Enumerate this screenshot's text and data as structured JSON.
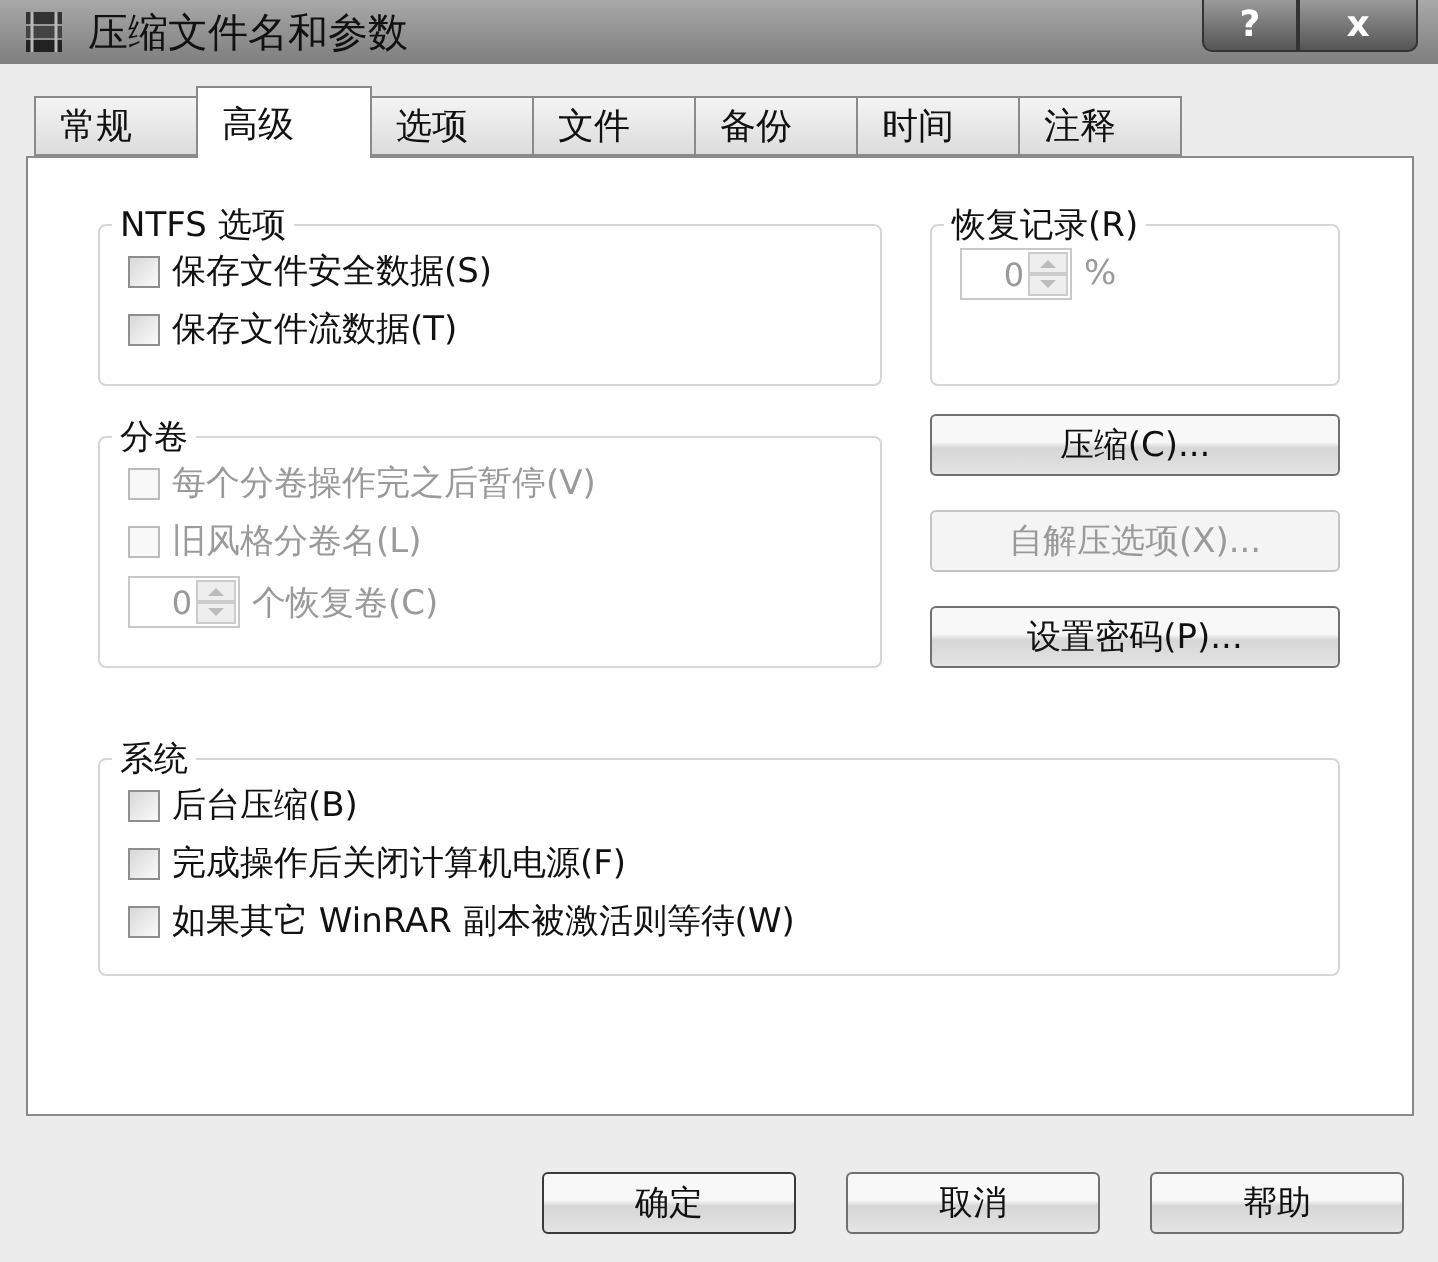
{
  "window": {
    "title": "压缩文件名和参数",
    "buttons": [
      {
        "kind": "help",
        "label": "?"
      },
      {
        "kind": "close",
        "label": "x"
      }
    ]
  },
  "tabs": [
    {
      "label": "常规",
      "selected": false
    },
    {
      "label": "高级",
      "selected": true
    },
    {
      "label": "选项",
      "selected": false
    },
    {
      "label": "文件",
      "selected": false
    },
    {
      "label": "备份",
      "selected": false
    },
    {
      "label": "时间",
      "selected": false
    },
    {
      "label": "注释",
      "selected": false
    }
  ],
  "ntfs_group": {
    "title": "NTFS 选项",
    "options": [
      {
        "label": "保存文件安全数据(S)",
        "checked": false,
        "disabled": false
      },
      {
        "label": "保存文件流数据(T)",
        "checked": false,
        "disabled": false
      }
    ]
  },
  "recovery_group": {
    "title": "恢复记录(R)",
    "spin": {
      "value": "0",
      "unit": "%",
      "disabled": true
    }
  },
  "volume_group": {
    "title": "分卷",
    "options": [
      {
        "label": "每个分卷操作完之后暂停(V)",
        "checked": false,
        "disabled": true
      },
      {
        "label": "旧风格分卷名(L)",
        "checked": false,
        "disabled": true
      }
    ],
    "spin": {
      "value": "0",
      "unit": "个恢复卷(C)",
      "disabled": true
    }
  },
  "side_buttons": [
    {
      "label": "压缩(C)...",
      "disabled": false
    },
    {
      "label": "自解压选项(X)...",
      "disabled": true
    },
    {
      "label": "设置密码(P)...",
      "disabled": false
    }
  ],
  "system_group": {
    "title": "系统",
    "options": [
      {
        "label": "后台压缩(B)",
        "checked": false,
        "disabled": false
      },
      {
        "label": "完成操作后关闭计算机电源(F)",
        "checked": false,
        "disabled": false
      },
      {
        "label": "如果其它 WinRAR 副本被激活则等待(W)",
        "checked": false,
        "disabled": false
      }
    ]
  },
  "footer_buttons": [
    {
      "label": "确定",
      "default": true
    },
    {
      "label": "取消",
      "default": false
    },
    {
      "label": "帮助",
      "default": false
    }
  ]
}
